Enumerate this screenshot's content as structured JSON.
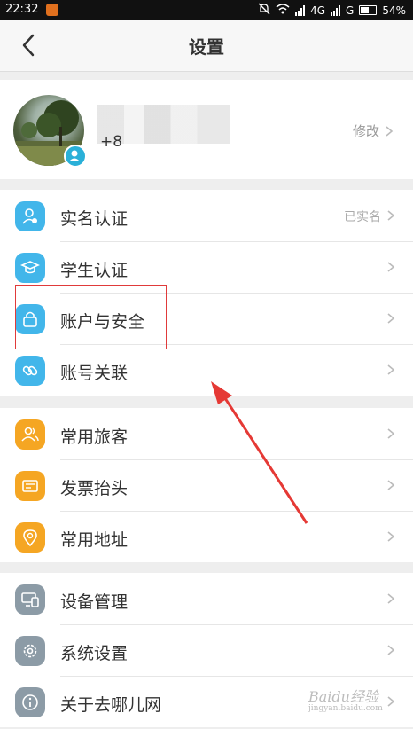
{
  "status_bar": {
    "time": "22:32",
    "network": "4G",
    "network2": "G",
    "battery": "54%"
  },
  "nav": {
    "title": "设置"
  },
  "profile": {
    "phone_prefix": "+8",
    "edit_label": "修改"
  },
  "groups": [
    {
      "items": [
        {
          "label": "实名认证",
          "value": "已实名",
          "icon": "person-id-icon",
          "color": "#42b6ea"
        },
        {
          "label": "学生认证",
          "value": "",
          "icon": "graduation-cap-icon",
          "color": "#42b6ea"
        },
        {
          "label": "账户与安全",
          "value": "",
          "icon": "lock-icon",
          "color": "#42b6ea"
        },
        {
          "label": "账号关联",
          "value": "",
          "icon": "link-icon",
          "color": "#42b6ea"
        }
      ]
    },
    {
      "items": [
        {
          "label": "常用旅客",
          "value": "",
          "icon": "people-icon",
          "color": "#f5a623"
        },
        {
          "label": "发票抬头",
          "value": "",
          "icon": "invoice-icon",
          "color": "#f5a623"
        },
        {
          "label": "常用地址",
          "value": "",
          "icon": "location-pin-icon",
          "color": "#f5a623"
        }
      ]
    },
    {
      "items": [
        {
          "label": "设备管理",
          "value": "",
          "icon": "devices-icon",
          "color": "#8c9ba6"
        },
        {
          "label": "系统设置",
          "value": "",
          "icon": "gear-icon",
          "color": "#8c9ba6"
        },
        {
          "label": "关于去哪儿网",
          "value": "",
          "icon": "info-icon",
          "color": "#8c9ba6"
        }
      ]
    }
  ],
  "watermark": {
    "main": "Baidu经验",
    "sub": "jingyan.baidu.com"
  }
}
